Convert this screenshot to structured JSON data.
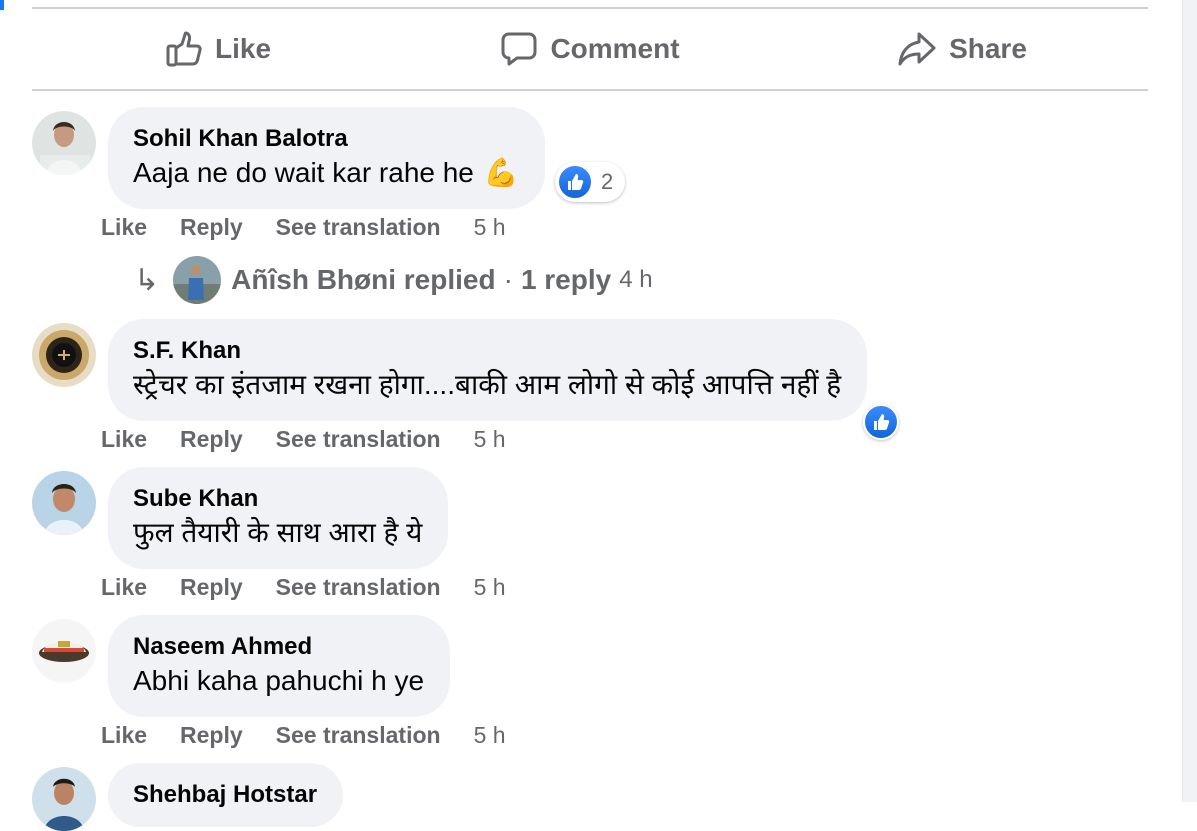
{
  "actions": {
    "like": "Like",
    "comment": "Comment",
    "share": "Share"
  },
  "meta_labels": {
    "like": "Like",
    "reply": "Reply",
    "see_translation": "See translation"
  },
  "colors": {
    "accent": "#1877f2",
    "bubble": "#f0f2f5",
    "secondary_text": "#65676b"
  },
  "comments": [
    {
      "author": "Sohil Khan Balotra",
      "text": "Aaja ne do wait kar rahe he",
      "emoji": "💪",
      "reaction_icon": "like-icon",
      "reaction_count": "2",
      "time": "5 h"
    },
    {
      "author": "S.F. Khan",
      "text": "स्ट्रेचर का इंतजाम रखना होगा....बाकी आम लोगो से कोई आपत्ति नहीं है",
      "reaction_icon": "like-icon",
      "time": "5 h"
    },
    {
      "author": "Sube Khan",
      "text": "फुल तैयारी के साथ आरा है ये",
      "time": "5 h"
    },
    {
      "author": "Naseem Ahmed",
      "text": "Abhi kaha pahuchi h ye",
      "time": "5 h"
    },
    {
      "author": "Shehbaj Hotstar"
    }
  ],
  "reply_thread": {
    "name_replied": "Añîsh Bhøni replied",
    "separator": "·",
    "count": "1 reply",
    "time": "4 h"
  }
}
